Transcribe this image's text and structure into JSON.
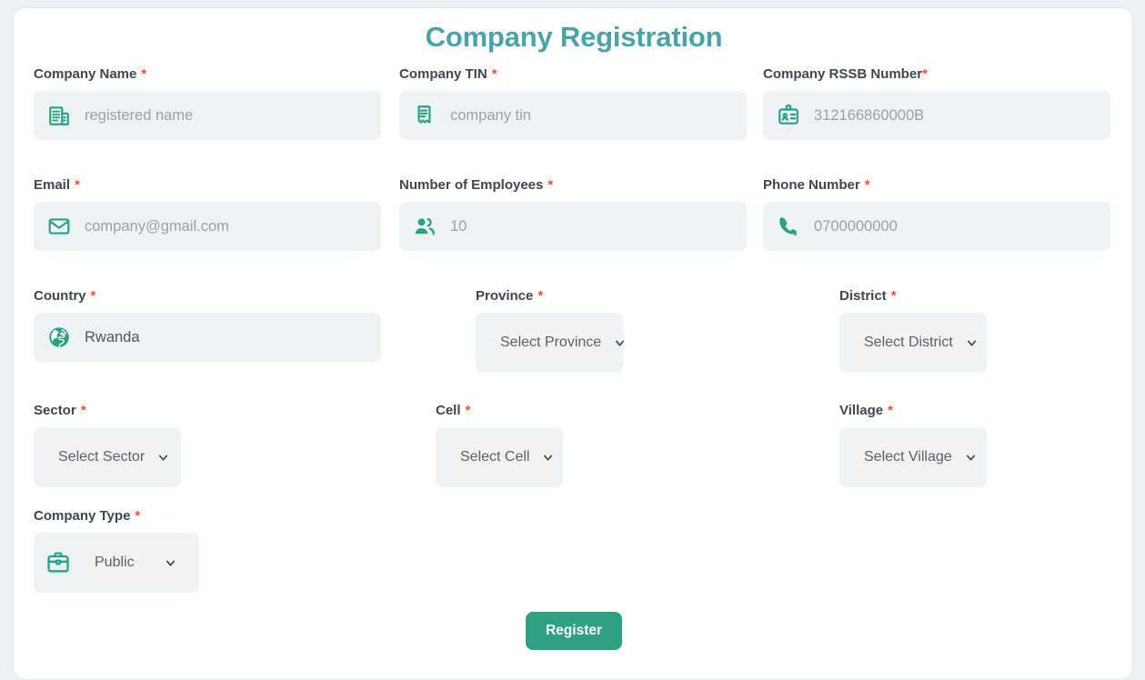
{
  "header": {
    "title": "Company Registration"
  },
  "colors": {
    "title": "#4aa3ab",
    "icon": "#26a187",
    "required": "#f4512c",
    "button": "#2fa183",
    "field_bg": "#eef2f2",
    "select_bg": "#f2f2f2",
    "page_bg": "#eef1f1"
  },
  "fields": {
    "company_name": {
      "label": "Company Name",
      "required": "*",
      "placeholder": "registered name",
      "icon": "building-icon"
    },
    "company_tin": {
      "label": "Company TIN",
      "required": "*",
      "placeholder": "company tin",
      "icon": "receipt-icon"
    },
    "company_rssb": {
      "label": "Company RSSB Number",
      "required": "*",
      "placeholder": "312166860000B",
      "icon": "id-badge-icon"
    },
    "email": {
      "label": "Email",
      "required": "*",
      "placeholder": "company@gmail.com",
      "icon": "envelope-icon"
    },
    "employees": {
      "label": "Number of Employees",
      "required": "*",
      "placeholder": "10",
      "icon": "users-icon"
    },
    "phone": {
      "label": "Phone Number",
      "required": "*",
      "placeholder": "0700000000",
      "icon": "phone-icon"
    },
    "country": {
      "label": "Country",
      "required": "*",
      "value": "Rwanda",
      "icon": "globe-icon"
    },
    "province": {
      "label": "Province",
      "required": "*",
      "selected": "Select Province",
      "icon": "chevron-down-icon"
    },
    "district": {
      "label": "District",
      "required": "*",
      "selected": "Select District",
      "icon": "chevron-down-icon"
    },
    "sector": {
      "label": "Sector",
      "required": "*",
      "selected": "Select Sector",
      "icon": "chevron-down-icon"
    },
    "cell": {
      "label": "Cell",
      "required": "*",
      "selected": "Select Cell",
      "icon": "chevron-down-icon"
    },
    "village": {
      "label": "Village",
      "required": "*",
      "selected": "Select Village",
      "icon": "chevron-down-icon"
    },
    "company_type": {
      "label": "Company Type",
      "required": "*",
      "selected": "Public",
      "icon": "briefcase-icon"
    }
  },
  "actions": {
    "register": "Register"
  }
}
